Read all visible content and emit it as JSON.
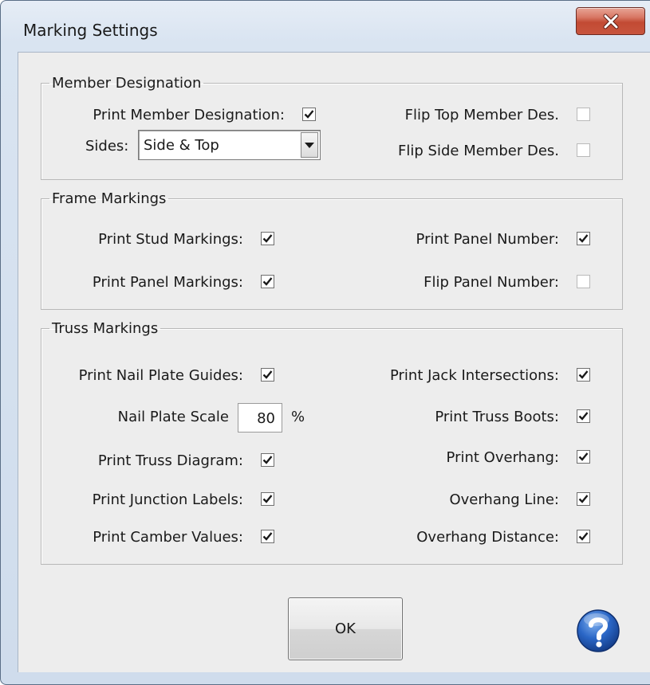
{
  "window": {
    "title": "Marking Settings"
  },
  "member_designation": {
    "legend": "Member Designation",
    "print_label": "Print Member Designation:",
    "print_checked": true,
    "sides_label": "Sides:",
    "sides_value": "Side & Top",
    "flip_top_label": "Flip Top Member Des.",
    "flip_top_checked": false,
    "flip_side_label": "Flip Side Member Des.",
    "flip_side_checked": false
  },
  "frame_markings": {
    "legend": "Frame Markings",
    "print_stud_label": "Print Stud Markings:",
    "print_stud_checked": true,
    "print_panel_markings_label": "Print Panel Markings:",
    "print_panel_markings_checked": true,
    "print_panel_number_label": "Print Panel Number:",
    "print_panel_number_checked": true,
    "flip_panel_number_label": "Flip Panel Number:",
    "flip_panel_number_checked": false
  },
  "truss_markings": {
    "legend": "Truss Markings",
    "nail_plate_guides_label": "Print Nail Plate Guides:",
    "nail_plate_guides_checked": true,
    "nail_plate_scale_label": "Nail Plate Scale",
    "nail_plate_scale_value": "80",
    "nail_plate_scale_unit": "%",
    "truss_diagram_label": "Print Truss Diagram:",
    "truss_diagram_checked": true,
    "junction_labels_label": "Print Junction Labels:",
    "junction_labels_checked": true,
    "camber_values_label": "Print Camber Values:",
    "camber_values_checked": true,
    "jack_intersections_label": "Print Jack Intersections:",
    "jack_intersections_checked": true,
    "truss_boots_label": "Print Truss Boots:",
    "truss_boots_checked": true,
    "overhang_label": "Print Overhang:",
    "overhang_checked": true,
    "overhang_line_label": "Overhang Line:",
    "overhang_line_checked": true,
    "overhang_distance_label": "Overhang Distance:",
    "overhang_distance_checked": true
  },
  "buttons": {
    "ok_label": "OK"
  },
  "icons": {
    "close": "close-icon",
    "help": "help-icon",
    "dropdown": "chevron-down-icon"
  },
  "colors": {
    "close_button": "#c8553e",
    "help_blue": "#1e5bb8",
    "client_bg": "#ededed"
  }
}
